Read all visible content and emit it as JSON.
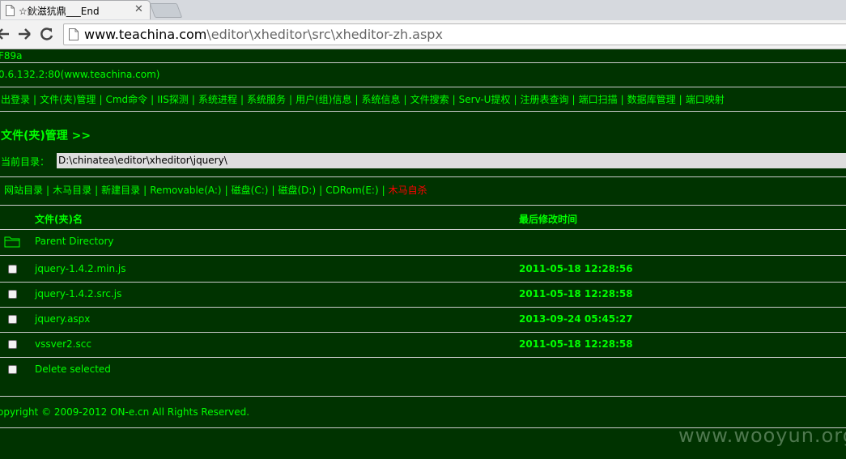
{
  "browser": {
    "tab_title": "☆鈥滋犺鼎___End",
    "url_host": "www.teachina.com",
    "url_path": "\\editor\\xheditor\\src\\xheditor-zh.aspx"
  },
  "header": {
    "line1": "F89a",
    "line2": "0.6.132.2:80(www.teachina.com)"
  },
  "menu": {
    "items": [
      "出登录",
      "文件(夹)管理",
      "Cmd命令",
      "IIS探测",
      "系统进程",
      "系统服务",
      "用户(组)信息",
      "系统信息",
      "文件搜索",
      "Serv-U提权",
      "注册表查询",
      "端口扫描",
      "数据库管理",
      "端口映射"
    ],
    "separator": "|"
  },
  "section": {
    "title": "文件(夹)管理 >>",
    "current_dir_label": "当前目录：",
    "current_dir_value": "D:\\chinatea\\editor\\xheditor\\jquery\\"
  },
  "drives": {
    "items": [
      "网站目录",
      "木马目录",
      "新建目录",
      "Removable(A:)",
      "磁盘(C:)",
      "磁盘(D:)",
      "CDRom(E:)"
    ],
    "danger_item": "木马自杀",
    "danger_color": "#ff0000"
  },
  "table": {
    "headers": [
      "文件(夹)名",
      "最后修改时间"
    ],
    "parent_dir": "Parent Directory",
    "rows": [
      {
        "name": "jquery-1.4.2.min.js",
        "time": "2011-05-18 12:28:56"
      },
      {
        "name": "jquery-1.4.2.src.js",
        "time": "2011-05-18 12:28:58"
      },
      {
        "name": "jquery.aspx",
        "time": "2013-09-24 05:45:27"
      },
      {
        "name": "vssver2.scc",
        "time": "2011-05-18 12:28:58"
      }
    ],
    "delete_label": "Delete selected"
  },
  "footer": {
    "copyright": "opyright © 2009-2012 ON-e.cn All Rights Reserved."
  },
  "watermark": "www.wooyun.org",
  "colors": {
    "background": "#003300",
    "text": "#00ff00",
    "divider": "#cccccc"
  }
}
